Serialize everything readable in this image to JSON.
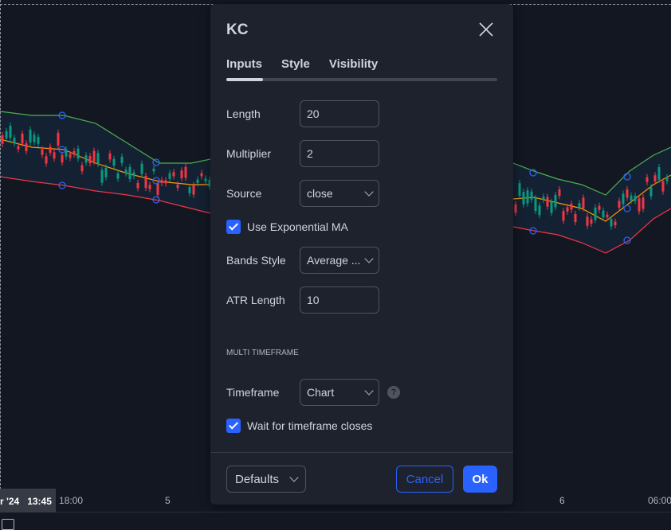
{
  "dialog": {
    "title": "KC",
    "tabs": [
      {
        "label": "Inputs",
        "active": true
      },
      {
        "label": "Style"
      },
      {
        "label": "Visibility"
      }
    ],
    "inputs": {
      "length": {
        "label": "Length",
        "value": "20"
      },
      "multiplier": {
        "label": "Multiplier",
        "value": "2"
      },
      "source": {
        "label": "Source",
        "value": "close"
      },
      "use_ema": {
        "label": "Use Exponential MA",
        "checked": true
      },
      "bands_style": {
        "label": "Bands Style",
        "value": "Average ..."
      },
      "atr_length": {
        "label": "ATR Length",
        "value": "10"
      }
    },
    "section": "MULTI TIMEFRAME",
    "timeframe": {
      "label": "Timeframe",
      "value": "Chart",
      "help": "?"
    },
    "wait_closes": {
      "label": "Wait for timeframe closes",
      "checked": true
    },
    "footer": {
      "defaults": "Defaults",
      "cancel": "Cancel",
      "ok": "Ok"
    }
  },
  "time_axis": {
    "highlight": "r '24   13:45",
    "labels": [
      "18:00",
      "5",
      "6",
      "06:00"
    ]
  },
  "colors": {
    "accent": "#2962ff",
    "upper": "#4caf50",
    "basis": "#ff9800",
    "lower": "#f23645",
    "up": "#089981",
    "down": "#f23645"
  }
}
